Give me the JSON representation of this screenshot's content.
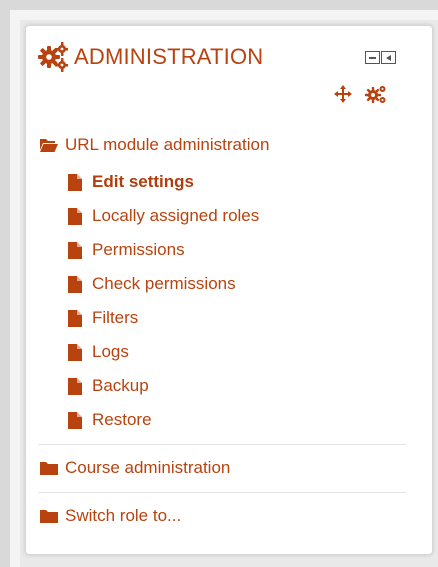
{
  "block": {
    "title": "ADMINISTRATION",
    "icons": [
      "gears-icon",
      "hide-block-icon",
      "dock-block-icon",
      "move-icon",
      "actions-gear-icon"
    ]
  },
  "tree": {
    "module_admin": {
      "label": "URL module administration",
      "items": [
        {
          "label": "Edit settings",
          "active": true
        },
        {
          "label": "Locally assigned roles"
        },
        {
          "label": "Permissions"
        },
        {
          "label": "Check permissions"
        },
        {
          "label": "Filters"
        },
        {
          "label": "Logs"
        },
        {
          "label": "Backup"
        },
        {
          "label": "Restore"
        }
      ]
    },
    "course_admin": {
      "label": "Course administration"
    },
    "switch_role": {
      "label": "Switch role to..."
    }
  },
  "colors": {
    "accent": "#b8430f"
  }
}
